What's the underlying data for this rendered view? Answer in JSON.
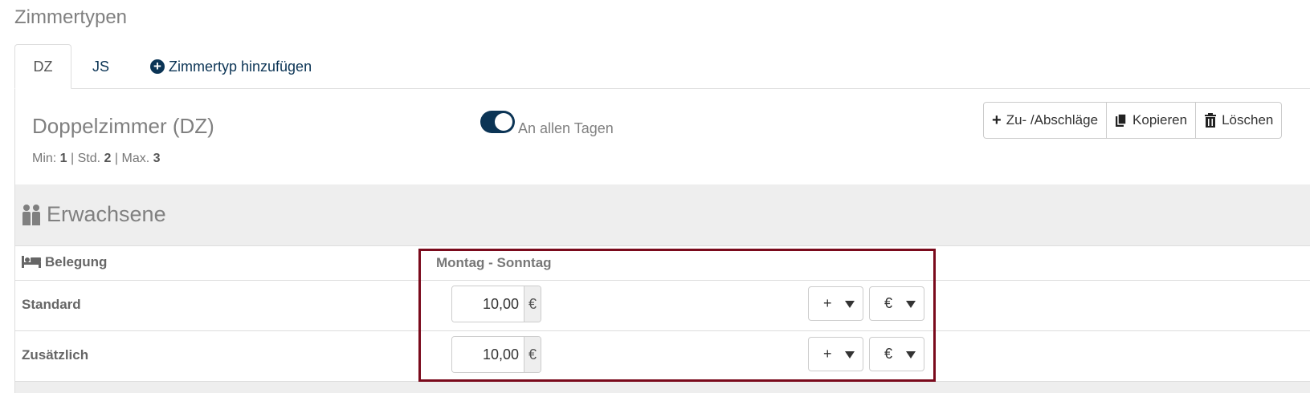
{
  "page": {
    "title": "Zimmertypen"
  },
  "tabs": [
    {
      "label": "DZ",
      "active": true
    },
    {
      "label": "JS",
      "active": false
    },
    {
      "label": "Zimmertyp hinzufügen",
      "icon": "plus-circle-icon"
    }
  ],
  "room": {
    "title": "Doppelzimmer (DZ)",
    "min_label": "Min: ",
    "min_value": "1",
    "std_label": " | Std. ",
    "std_value": "2",
    "max_label": " | Max. ",
    "max_value": "3",
    "toggle_label": "An allen Tagen",
    "toggle_on": true
  },
  "actions": {
    "surcharge_label": "Zu- /Abschläge",
    "copy_label": "Kopieren",
    "delete_label": "Löschen"
  },
  "section": {
    "title": "Erwachsene",
    "occupancy_header": "Belegung",
    "day_range_header": "Montag - Sonntag",
    "rows": [
      {
        "label": "Standard",
        "value": "10,00",
        "unit": "€",
        "operator": "+",
        "currency": "€"
      },
      {
        "label": "Zusätzlich",
        "value": "10,00",
        "unit": "€",
        "operator": "+",
        "currency": "€"
      }
    ]
  },
  "colors": {
    "accent": "#0b3455",
    "highlight": "#7a0a1c",
    "section_bg": "#eeeeee"
  }
}
